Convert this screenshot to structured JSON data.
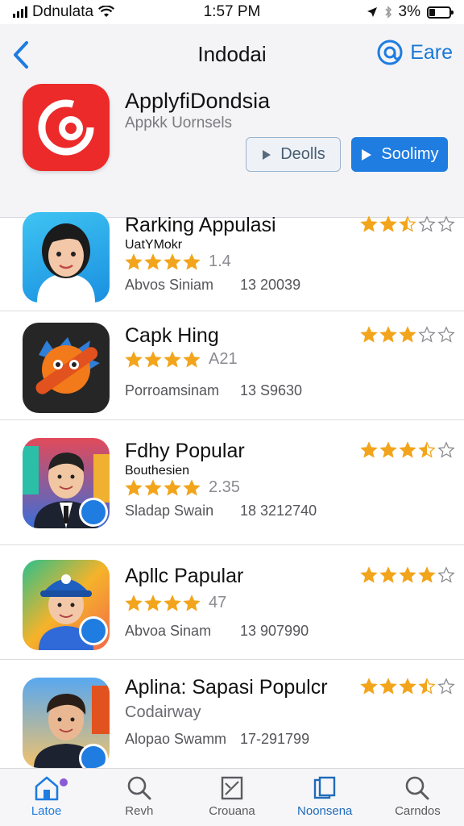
{
  "status_bar": {
    "carrier": "Ddnulata",
    "time": "1:57 PM",
    "battery": "3%",
    "battery_level": 0.3
  },
  "header": {
    "title": "Indodai",
    "action_label": "Eare",
    "app_name": "ApplyfiDondsia",
    "app_subtitle": "Appkk Uornsels",
    "details_label": "Deolls",
    "primary_label": "Soolimy",
    "brand_color": "#ec2a2a",
    "accent_color": "#1f7ce0"
  },
  "list": [
    {
      "title": "Rarking Appulasi",
      "subtitle": "UatYMokr",
      "stars_score": "1.4",
      "author": "Abvos Siniam",
      "count": "13 20039",
      "rating": 2.5,
      "avatar": "woman-avatar"
    },
    {
      "title": "Capk Hing",
      "subtitle": "",
      "stars_score": "A21",
      "author": "Porroamsinam",
      "count": "13 S9630",
      "rating": 3,
      "avatar": "orange-creature"
    },
    {
      "title": "Fdhy Popular",
      "subtitle": "Bouthesien",
      "stars_score": "2.35",
      "author": "Sladap Swain",
      "count": "18 3212740",
      "rating": 3.5,
      "avatar": "man-suit"
    },
    {
      "title": "Apllc Papular",
      "subtitle": "",
      "stars_score": "47",
      "author": "Abvoa Sinam",
      "count": "13 907990",
      "rating": 4,
      "avatar": "cap-person"
    },
    {
      "title": "Aplina: Sapasi Populcr",
      "subtitle": "Codairway",
      "stars_score": "",
      "author": "Alopao Swamm",
      "count": "17-291799",
      "rating": 3.5,
      "avatar": "man-beach"
    }
  ],
  "tabs": [
    {
      "label": "Latoe",
      "icon": "home-icon",
      "active": true
    },
    {
      "label": "Revh",
      "icon": "search-icon",
      "active": false
    },
    {
      "label": "Crouana",
      "icon": "frame-icon",
      "active": false
    },
    {
      "label": "Noonsena",
      "icon": "cards-icon",
      "active": false
    },
    {
      "label": "Carndos",
      "icon": "search-icon",
      "active": false
    }
  ]
}
